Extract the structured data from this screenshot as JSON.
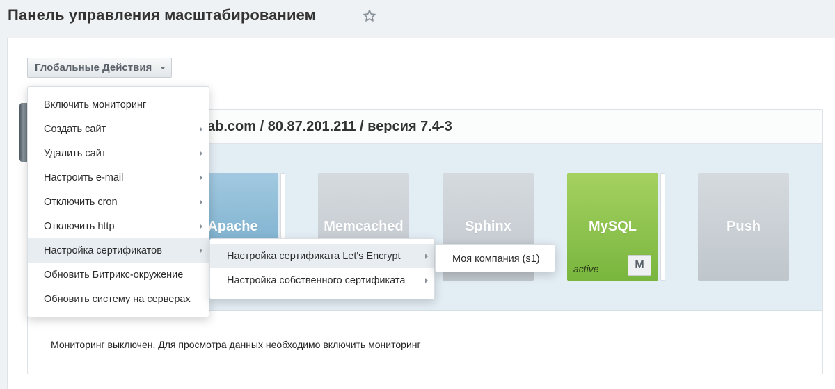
{
  "header": {
    "title": "Панель управления масштабированием",
    "favorite_icon": "star-icon"
  },
  "toolbar": {
    "actions_label": "Глобальные Действия"
  },
  "server": {
    "title": "ab.com / 80.87.201.211 / версия 7.4-3"
  },
  "roles": [
    {
      "name": "Apache"
    },
    {
      "name": "Memcached"
    },
    {
      "name": "Sphinx"
    },
    {
      "name": "MySQL",
      "status": "active",
      "badge": "M"
    },
    {
      "name": "Push"
    }
  ],
  "main_menu": {
    "items": [
      {
        "label": "Включить мониторинг",
        "submenu": false
      },
      {
        "label": "Создать сайт",
        "submenu": true
      },
      {
        "label": "Удалить сайт",
        "submenu": true
      },
      {
        "label": "Настроить e-mail",
        "submenu": true
      },
      {
        "label": "Отключить cron",
        "submenu": true
      },
      {
        "label": "Отключить http",
        "submenu": true
      },
      {
        "label": "Настройка сертификатов",
        "submenu": true,
        "hovered": true
      },
      {
        "label": "Обновить Битрикс-окружение",
        "submenu": false
      },
      {
        "label": "Обновить систему на серверах",
        "submenu": false
      }
    ]
  },
  "cert_menu": {
    "items": [
      {
        "label": "Настройка сертификата Let's Encrypt",
        "submenu": true,
        "hovered": true
      },
      {
        "label": "Настройка собственного сертификата",
        "submenu": true
      }
    ]
  },
  "site_menu": {
    "items": [
      {
        "label": "Моя компания (s1)",
        "submenu": false
      }
    ]
  },
  "monitoring": {
    "message": "Мониторинг выключен. Для просмотра данных необходимо включить мониторинг"
  },
  "colors": {
    "page_background": "#eef2f4",
    "role_inactive": "#c9cfd4",
    "role_apache": "#7fb2d0",
    "role_mysql": "#8dc34f",
    "menu_hover": "#e7edf1"
  }
}
